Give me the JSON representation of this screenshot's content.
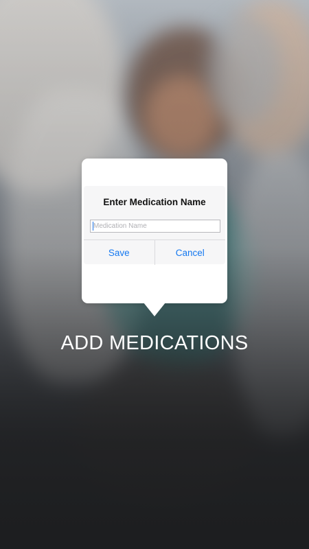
{
  "dialog": {
    "title": "Enter Medication Name",
    "input": {
      "placeholder": "Medication Name",
      "value": ""
    },
    "save_label": "Save",
    "cancel_label": "Cancel",
    "accent_color": "#1478f0"
  },
  "headline": "ADD MEDICATIONS"
}
